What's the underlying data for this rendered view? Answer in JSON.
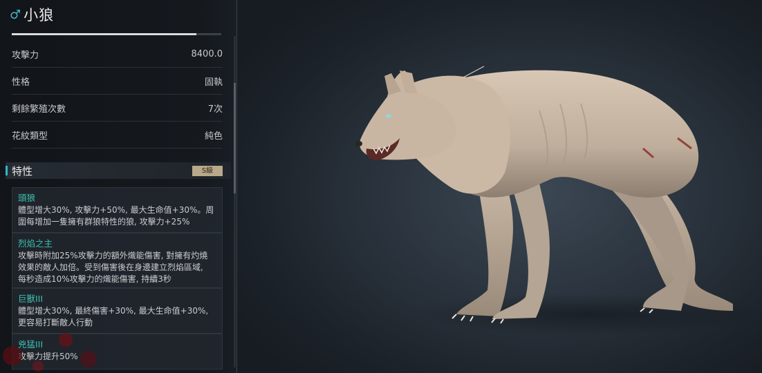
{
  "pet": {
    "gender_symbol": "♂",
    "name": "小狼",
    "xp_progress": 0.88
  },
  "stats": [
    {
      "label": "攻擊力",
      "value": "8400.0"
    },
    {
      "label": "性格",
      "value": "固執"
    },
    {
      "label": "剩餘繁殖次數",
      "value": "7次"
    },
    {
      "label": "花紋類型",
      "value": "純色"
    }
  ],
  "traits": {
    "title": "特性",
    "grade": "S級",
    "items": [
      {
        "name": "頭狼",
        "desc_lines": [
          "體型增大30%, 攻擊力+50%, 最大生命值+30%。周",
          "圍每增加一隻擁有群狼特性的狼, 攻擊力+25%"
        ]
      },
      {
        "name": "烈焰之主",
        "desc_lines": [
          "攻擊時附加25%攻擊力的額外熾能傷害, 對擁有灼燒",
          "效果的敵人加倍。受到傷害後在身邊建立烈焰區域,",
          "每秒造成10%攻擊力的熾能傷害, 持續3秒"
        ]
      },
      {
        "name": "巨獸III",
        "desc_lines": [
          "體型增大30%, 最終傷害+30%, 最大生命值+30%,",
          "更容易打斷敵人行動"
        ]
      },
      {
        "name": "兇猛III",
        "desc_lines": [
          "攻擊力提升50%"
        ]
      }
    ]
  },
  "colors": {
    "accent": "#34b8c9",
    "trait_name": "#3cc0b0",
    "grade_badge": "#b9a98a"
  }
}
